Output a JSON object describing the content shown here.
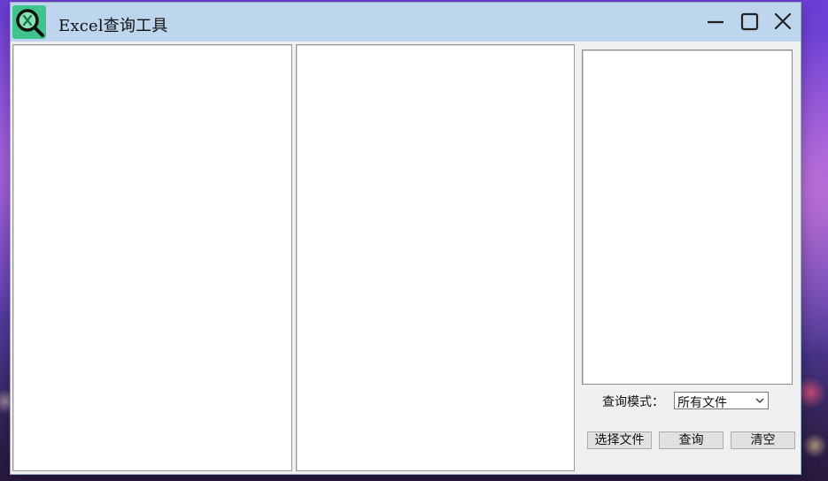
{
  "window": {
    "title": "Excel查询工具",
    "icon": "excel-search-icon"
  },
  "titlebar_buttons": {
    "minimize_icon": "minimize-icon",
    "maximize_icon": "maximize-icon",
    "close_icon": "close-icon"
  },
  "controls": {
    "mode_label": "查询模式：",
    "mode_value": "所有文件",
    "buttons": {
      "select_file": "选择文件",
      "query": "查询",
      "clear": "清空"
    }
  },
  "colors": {
    "titlebar": "#bdd6ee",
    "icon_bg": "#3fc48e",
    "window_bg": "#f0f0f0"
  }
}
